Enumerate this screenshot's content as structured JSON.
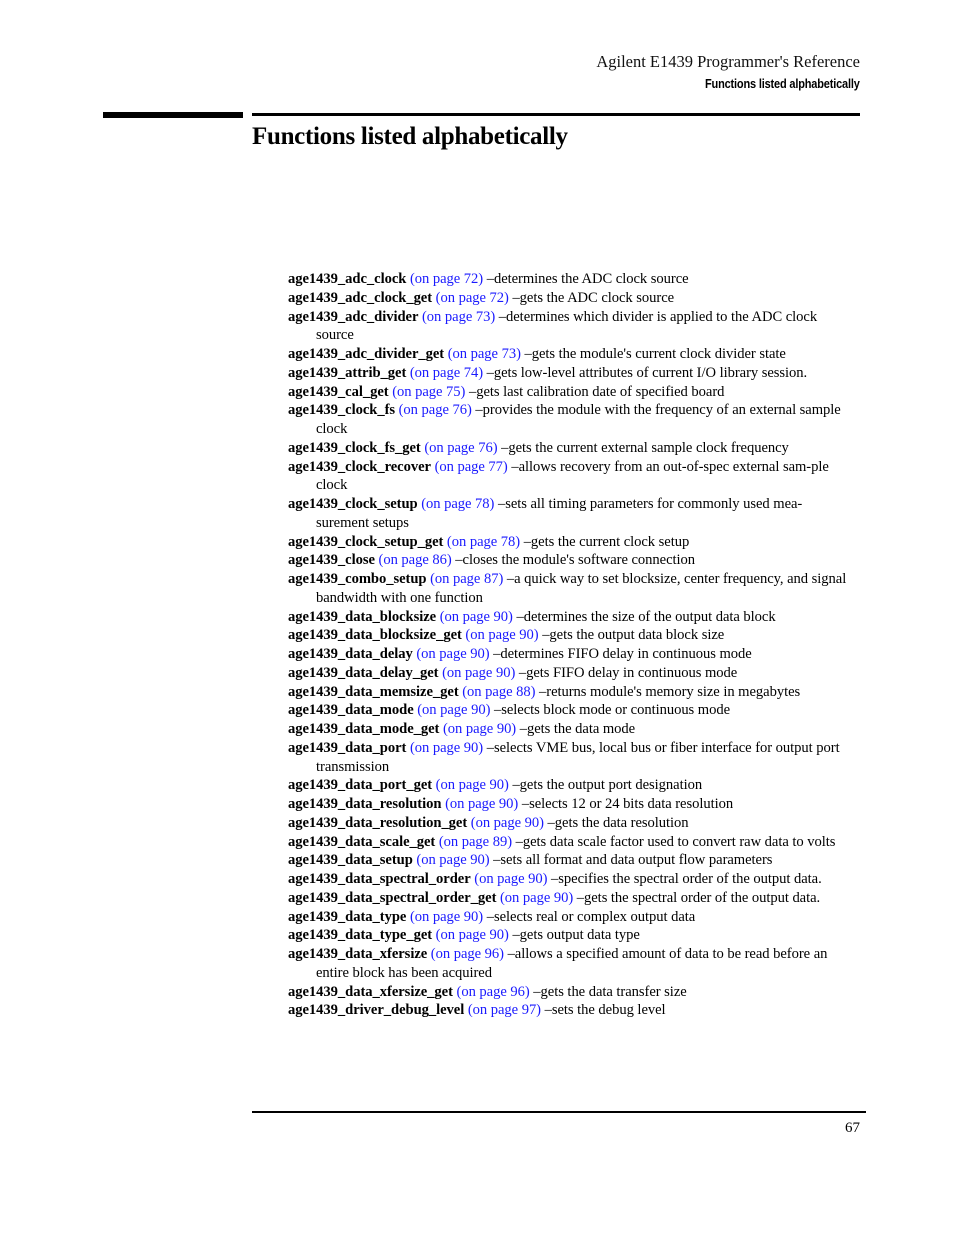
{
  "header": {
    "doc_title": "Agilent E1439 Programmer's Reference",
    "section_name": "Functions listed alphabetically"
  },
  "chapter": {
    "title": "Functions listed alphabetically"
  },
  "colors": {
    "link": "#1a1aff",
    "text": "#000000",
    "rule": "#000000"
  },
  "functions": [
    {
      "name": "age1439_adc_clock",
      "link": "(on page 72)",
      "desc": "–determines the ADC clock source"
    },
    {
      "name": "age1439_adc_clock_get",
      "link": "(on page 72)",
      "desc": "–gets the ADC clock source"
    },
    {
      "name": "age1439_adc_divider",
      "link": "(on page 73)",
      "desc": "–determines which divider is applied to the ADC clock source"
    },
    {
      "name": "age1439_adc_divider_get",
      "link": " (on page 73)",
      "desc": "–gets the module's current clock divider state"
    },
    {
      "name": "age1439_attrib_get",
      "link": "(on page 74)",
      "desc": "–gets low-level attributes of current I/O library session."
    },
    {
      "name": "age1439_cal_get",
      "link": "(on page 75)",
      "desc": "–gets last calibration date of specified board"
    },
    {
      "name": "age1439_clock_fs",
      "link": "(on page 76)",
      "desc": "–provides the module with the frequency of an external sample clock"
    },
    {
      "name": "age1439_clock_fs_get",
      "link": "(on page 76)",
      "desc": "–gets the current external sample clock frequency"
    },
    {
      "name": "age1439_clock_recover",
      "link": "(on page 77)",
      "desc": "–allows recovery from an out-of-spec external sam-ple clock"
    },
    {
      "name": "age1439_clock_setup",
      "link": "(on page 78)",
      "desc": "–sets all timing parameters for commonly used mea-surement setups"
    },
    {
      "name": "age1439_clock_setup_get",
      "link": "(on page 78)",
      "desc": "–gets the current clock setup"
    },
    {
      "name": "age1439_close",
      "link": "(on page 86)",
      "desc": "–closes the module's software connection"
    },
    {
      "name": "age1439_combo_setup",
      "link": "(on page 87)",
      "desc": "–a quick way to set blocksize, center frequency, and signal bandwidth with one function"
    },
    {
      "name": "age1439_data_blocksize",
      "link": "(on page 90)",
      "desc": "–determines the size of the output data block"
    },
    {
      "name": "age1439_data_blocksize_get",
      "link": "(on page 90)",
      "desc": "–gets the output data block size"
    },
    {
      "name": "age1439_data_delay",
      "link": "(on page 90)",
      "desc": "–determines FIFO delay in continuous mode"
    },
    {
      "name": "age1439_data_delay_get",
      "link": "(on page 90)",
      "desc": "–gets FIFO delay in continuous mode"
    },
    {
      "name": "age1439_data_memsize_get",
      "link": "(on page 88)",
      "desc": "–returns module's memory size in megabytes"
    },
    {
      "name": "age1439_data_mode",
      "link": "(on page 90)",
      "desc": "–selects block mode or continuous mode"
    },
    {
      "name": "age1439_data_mode_get",
      "link": "(on page 90)",
      "desc": "–gets the data mode"
    },
    {
      "name": "age1439_data_port",
      "link": "(on page 90)",
      "desc": "–selects VME bus, local bus or fiber interface for output port transmission"
    },
    {
      "name": "age1439_data_port_get",
      "link": "(on page 90)",
      "desc": "–gets the output port designation"
    },
    {
      "name": "age1439_data_resolution",
      "link": "(on page 90)",
      "desc": "–selects 12 or 24 bits data resolution"
    },
    {
      "name": "age1439_data_resolution_get",
      "link": "(on page 90)",
      "desc": "–gets the data resolution"
    },
    {
      "name": "age1439_data_scale_get",
      "link": "(on page 89)",
      "desc": "–gets data scale factor used to convert raw data to volts"
    },
    {
      "name": "age1439_data_setup",
      "link": "(on page 90)",
      "desc": "–sets all format and data output flow parameters"
    },
    {
      "name": "age1439_data_spectral_order",
      "link": "(on page 90)",
      "desc": "–specifies the spectral order of the output data."
    },
    {
      "name": "age1439_data_spectral_order_get",
      "link": "(on page 90)",
      "desc": "–gets the spectral order of the output data."
    },
    {
      "name": "age1439_data_type",
      "link": "(on page 90)",
      "desc": "–selects real or complex output data"
    },
    {
      "name": "age1439_data_type_get",
      "link": "(on page 90)",
      "desc": "–gets output data type"
    },
    {
      "name": "age1439_data_xfersize",
      "link": " (on page 96)",
      "desc": "–allows a specified amount of data to be read before an entire block has been acquired"
    },
    {
      "name": "age1439_data_xfersize_get",
      "link": " (on page 96)",
      "desc": "–gets the data transfer size"
    },
    {
      "name": "age1439_driver_debug_level",
      "link": "(on page 97)",
      "desc": "–sets the debug level"
    }
  ],
  "footer": {
    "page_number": "67"
  }
}
